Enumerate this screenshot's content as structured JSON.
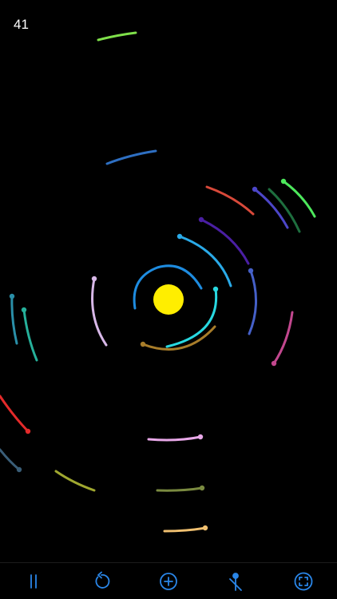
{
  "counter": "41",
  "colors": {
    "background": "#000000",
    "sun": "#FFEE00",
    "toolbar_icon": "#2A86E8"
  },
  "toolbar": {
    "buttons": [
      {
        "name": "pause-button",
        "icon": "pause-icon"
      },
      {
        "name": "reset-button",
        "icon": "rotate-ccw-icon"
      },
      {
        "name": "add-button",
        "icon": "plus-circle-icon"
      },
      {
        "name": "gravity-button",
        "icon": "pin-slash-icon"
      },
      {
        "name": "fit-view-button",
        "icon": "focus-frame-icon"
      }
    ]
  }
}
